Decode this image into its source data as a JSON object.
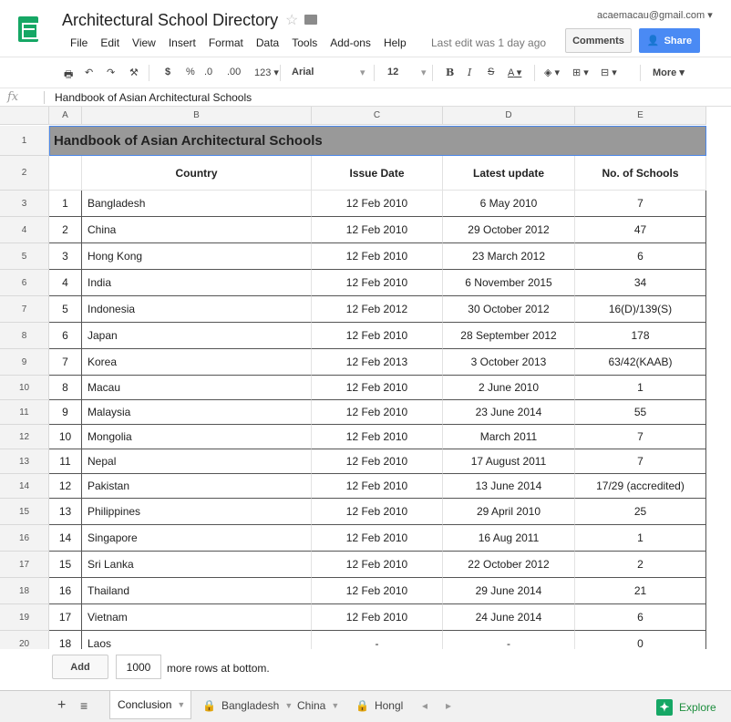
{
  "app": {
    "title": "Architectural School Directory",
    "account": "acaemacau@gmail.com",
    "last_edit": "Last edit was 1 day ago",
    "comments_label": "Comments",
    "share_label": "Share"
  },
  "menu": [
    "File",
    "Edit",
    "View",
    "Insert",
    "Format",
    "Data",
    "Tools",
    "Add-ons",
    "Help"
  ],
  "toolbar": {
    "currency": "$",
    "percent": "%",
    "decimal_dec": ".0",
    "decimal_inc": ".00",
    "number_format": "123",
    "font": "Arial",
    "font_size": "12",
    "bold": "B",
    "italic": "I",
    "strike": "S",
    "text_color": "A",
    "more": "More"
  },
  "formula_bar": {
    "fx": "fx",
    "content": "Handbook of Asian Architectural Schools"
  },
  "columns": [
    "A",
    "B",
    "C",
    "D",
    "E"
  ],
  "rows": {
    "title": "Handbook of Asian Architectural Schools",
    "headers": [
      "Country",
      "Issue Date",
      "Latest update",
      "No. of Schools"
    ],
    "data": [
      [
        "1",
        "Bangladesh",
        "12 Feb 2010",
        "6 May 2010",
        "7"
      ],
      [
        "2",
        "China",
        "12 Feb 2010",
        "29 October 2012",
        "47"
      ],
      [
        "3",
        "Hong Kong",
        "12 Feb 2010",
        "23 March 2012",
        "6"
      ],
      [
        "4",
        "India",
        "12 Feb 2010",
        "6 November 2015",
        "34"
      ],
      [
        "5",
        "Indonesia",
        "12 Feb 2012",
        "30 October 2012",
        "16(D)/139(S)"
      ],
      [
        "6",
        "Japan",
        "12 Feb 2010",
        "28 September 2012",
        "178"
      ],
      [
        "7",
        "Korea",
        "12 Feb 2013",
        "3 October 2013",
        "63/42(KAAB)"
      ],
      [
        "8",
        "Macau",
        "12 Feb 2010",
        "2 June 2010",
        "1"
      ],
      [
        "9",
        "Malaysia",
        "12 Feb 2010",
        "23 June 2014",
        "55"
      ],
      [
        "10",
        "Mongolia",
        "12 Feb 2010",
        "March 2011",
        "7"
      ],
      [
        "11",
        "Nepal",
        "12 Feb 2010",
        "17 August 2011",
        "7"
      ],
      [
        "12",
        "Pakistan",
        "12 Feb 2010",
        "13 June 2014",
        "17/29 (accredited)"
      ],
      [
        "13",
        "Philippines",
        "12 Feb 2010",
        "29 April 2010",
        "25"
      ],
      [
        "14",
        "Singapore",
        "12 Feb 2010",
        "16 Aug 2011",
        "1"
      ],
      [
        "15",
        "Sri Lanka",
        "12 Feb 2010",
        "22 October 2012",
        "2"
      ],
      [
        "16",
        "Thailand",
        "12 Feb 2010",
        "29 June 2014",
        "21"
      ],
      [
        "17",
        "Vietnam",
        "12 Feb 2010",
        "24 June 2014",
        "6"
      ],
      [
        "18",
        "Laos",
        "-",
        "-",
        "0"
      ]
    ]
  },
  "bottom": {
    "add_label": "Add",
    "rows_value": "1000",
    "rows_text": "more rows at bottom."
  },
  "tabs": [
    {
      "label": "Conclusion",
      "locked": false,
      "active": true
    },
    {
      "label": "Bangladesh",
      "locked": true,
      "active": false
    },
    {
      "label": "China",
      "locked": false,
      "active": false
    },
    {
      "label": "Hongl",
      "locked": true,
      "active": false
    }
  ],
  "explore_label": "Explore"
}
